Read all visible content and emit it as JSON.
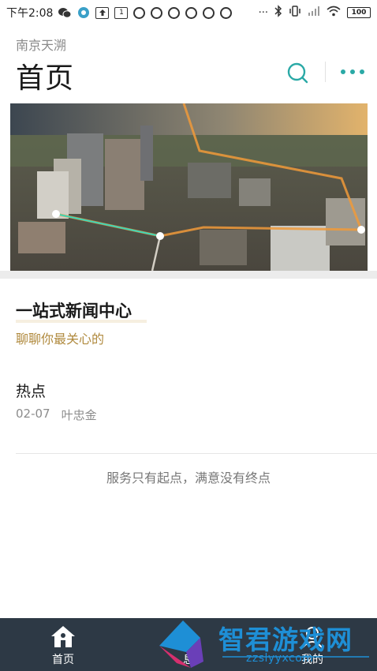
{
  "status_bar": {
    "time": "下午2:08",
    "notification_icons": [
      "wechat-icon",
      "browser-icon",
      "upload-icon",
      "calendar-icon",
      "q-icon",
      "q-icon",
      "q-icon",
      "q-icon",
      "q-icon",
      "q-icon"
    ],
    "calendar_day": "1",
    "more": "···",
    "right_icons": [
      "bluetooth-icon",
      "vibrate-icon",
      "signal-icon",
      "wifi-icon"
    ],
    "battery": "100"
  },
  "header": {
    "city": "南京天溯",
    "title": "首页"
  },
  "section": {
    "title": "一站式新闻中心",
    "subtitle": "聊聊你最关心的"
  },
  "news": {
    "title": "热点",
    "date": "02-07",
    "author": "叶忠金"
  },
  "slogan": "服务只有起点，满意没有终点",
  "bottom_nav": {
    "home_label": "首页",
    "middle_label": "息",
    "mine_label": "我的"
  },
  "watermark": {
    "text": "智君游戏网",
    "url": "zzslyyxcom"
  },
  "colors": {
    "accent": "#2aa9a6",
    "gold": "#b08a3e",
    "nav_bg": "#2d3945"
  }
}
